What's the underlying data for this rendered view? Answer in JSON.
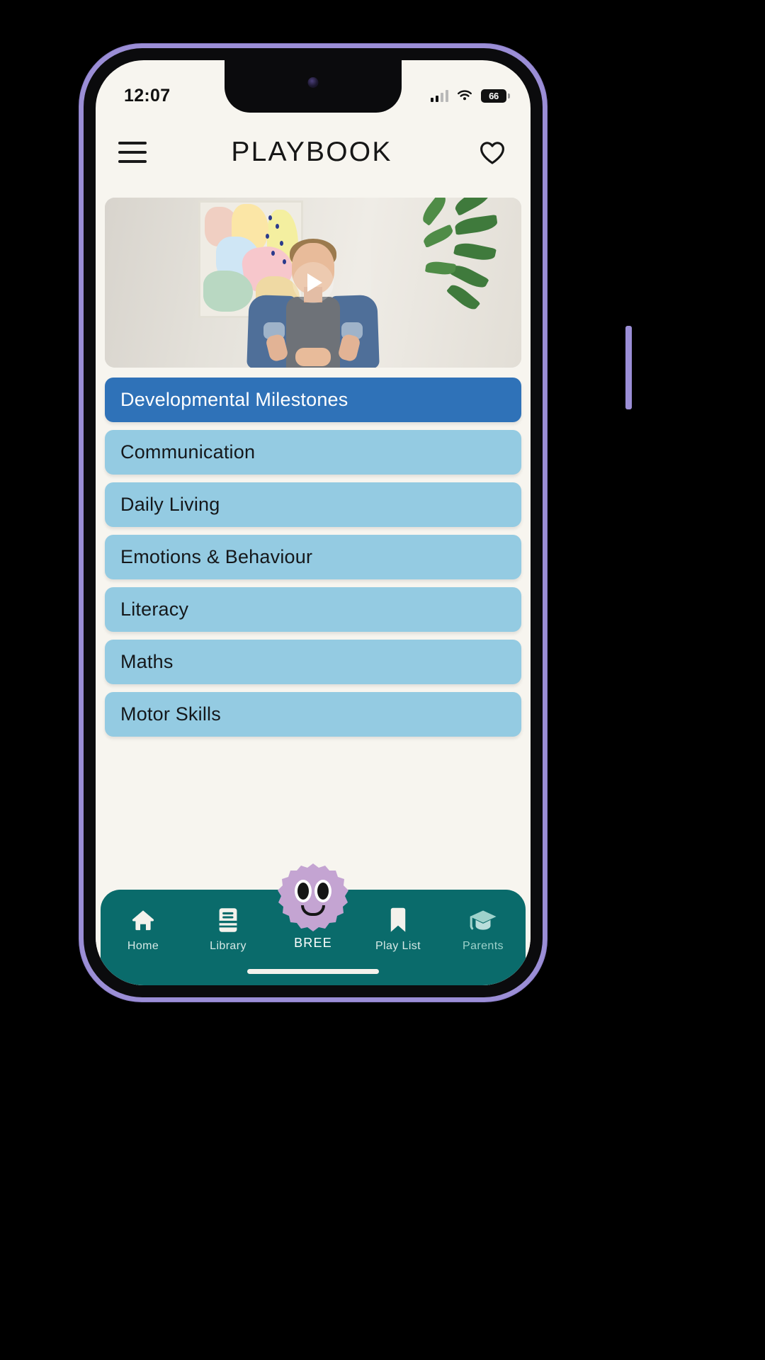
{
  "status_bar": {
    "time": "12:07",
    "battery_level": "66",
    "icons": [
      "signal-icon",
      "wifi-icon",
      "battery-icon"
    ]
  },
  "header": {
    "menu_icon": "hamburger-menu-icon",
    "title": "PLAYBOOK",
    "favorite_icon": "heart-icon"
  },
  "video": {
    "play_icon": "play-icon",
    "label": "intro-video"
  },
  "categories": [
    {
      "label": "Developmental Milestones",
      "active": true
    },
    {
      "label": "Communication",
      "active": false
    },
    {
      "label": "Daily Living",
      "active": false
    },
    {
      "label": "Emotions & Behaviour",
      "active": false
    },
    {
      "label": "Literacy",
      "active": false
    },
    {
      "label": "Maths",
      "active": false
    },
    {
      "label": "Motor Skills",
      "active": false
    }
  ],
  "bottom_nav": [
    {
      "label": "Home",
      "icon": "home-icon"
    },
    {
      "label": "Library",
      "icon": "book-icon"
    },
    {
      "label": "BREE",
      "icon": "bree-mascot-icon"
    },
    {
      "label": "Play List",
      "icon": "bookmark-icon"
    },
    {
      "label": "Parents",
      "icon": "graduation-cap-icon"
    }
  ],
  "colors": {
    "accent_active": "#2f72b8",
    "accent_light": "#94cbe2",
    "nav_bar": "#0a6b6b",
    "background": "#f7f5ef",
    "bree_blob": "#c4a4d2",
    "frame": "#9b8ed6"
  }
}
